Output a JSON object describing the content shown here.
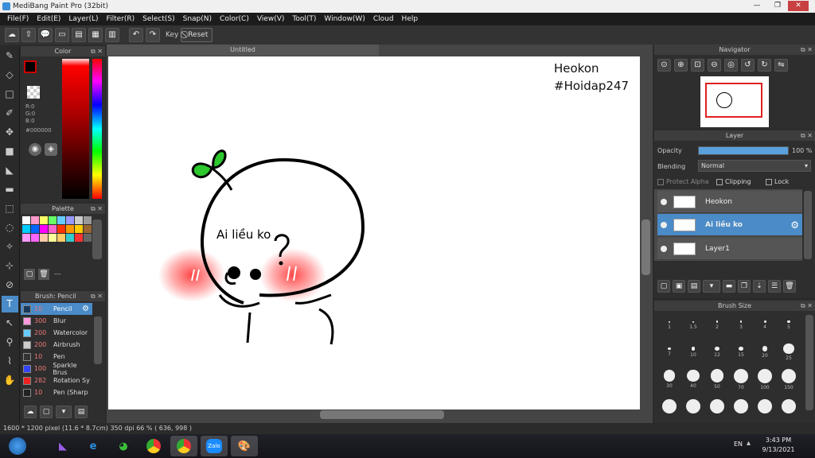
{
  "window": {
    "title": "MediBang Paint Pro (32bit)",
    "min": "—",
    "max": "❐",
    "close": "✕"
  },
  "menu": [
    "File(F)",
    "Edit(E)",
    "Layer(L)",
    "Filter(R)",
    "Select(S)",
    "Snap(N)",
    "Color(C)",
    "View(V)",
    "Tool(T)",
    "Window(W)",
    "Cloud",
    "Help"
  ],
  "toolbar": {
    "key_label": "Key",
    "reset_label": "Reset"
  },
  "color": {
    "title": "Color",
    "r": "R:0",
    "g": "G:0",
    "b": "B:0",
    "hex": "#000000",
    "main_color": "#000000",
    "accent": "#cc0000"
  },
  "palette": {
    "title": "Palette",
    "swatches": [
      "#ffffff",
      "#ff99cc",
      "#ffff66",
      "#66ff66",
      "#66ccff",
      "#9999ff",
      "#cccccc",
      "#999999",
      "#00ccff",
      "#0066ff",
      "#ff00ff",
      "#ff66cc",
      "#ff3300",
      "#ff9900",
      "#ffcc00",
      "#996633",
      "#ff99ff",
      "#ff66ff",
      "#ffccaa",
      "#ffff99",
      "#ffcc66",
      "#33cccc",
      "#ff3333",
      "#666666"
    ],
    "count": "---"
  },
  "brush": {
    "title": "Brush: Pencil",
    "items": [
      {
        "size": "10",
        "name": "Pencil",
        "color": "#1a3a5a"
      },
      {
        "size": "300",
        "name": "Blur",
        "color": "#ff99dd"
      },
      {
        "size": "200",
        "name": "Watercolor",
        "color": "#66ccff"
      },
      {
        "size": "200",
        "name": "Airbrush",
        "color": "#cccccc"
      },
      {
        "size": "10",
        "name": "Pen",
        "color": "#333333"
      },
      {
        "size": "100",
        "name": "Sparkle Brus",
        "color": "#3344ff"
      },
      {
        "size": "282",
        "name": "Rotation Sy",
        "color": "#ee2222"
      },
      {
        "size": "10",
        "name": "Pen (Sharp",
        "color": "#222222"
      }
    ]
  },
  "document": {
    "tab": "Untitled"
  },
  "canvas": {
    "watermark_line1": "Heokon",
    "watermark_line2": "#Hoidap247",
    "speech_text": "Ai liều ko"
  },
  "navigator": {
    "title": "Navigator"
  },
  "layer": {
    "title": "Layer",
    "opacity_label": "Opacity",
    "opacity_value": "100 %",
    "opacity_fraction": 1.0,
    "blending_label": "Blending",
    "blending_value": "Normal",
    "protect_alpha": "Protect Alpha",
    "clipping": "Clipping",
    "lock": "Lock",
    "layers": [
      {
        "name": "Heokon",
        "selected": false
      },
      {
        "name": "Ai liều ko",
        "selected": true
      },
      {
        "name": "Layer1",
        "selected": false
      }
    ]
  },
  "brush_size": {
    "title": "Brush Size",
    "sizes": [
      "1",
      "1.5",
      "2",
      "3",
      "4",
      "5",
      "7",
      "10",
      "12",
      "15",
      "20",
      "25",
      "30",
      "40",
      "50",
      "70",
      "100",
      "150",
      "",
      "",
      "",
      "",
      "",
      ""
    ]
  },
  "status": {
    "dimensions": "1600 * 1200 pixel",
    "physical": "(11.6 * 8.7cm)",
    "dpi": "350 dpi",
    "zoom": "66 %",
    "cursor": "( 636, 998 )"
  },
  "taskbar": {
    "lang": "EN",
    "time": "3:43 PM",
    "date": "9/13/2021"
  }
}
